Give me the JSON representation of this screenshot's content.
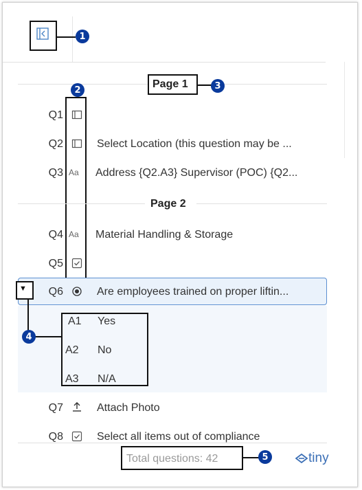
{
  "toolbar": {
    "collapse_icon": "collapse-panel-icon"
  },
  "pages": [
    {
      "label": "Page 1"
    },
    {
      "label": "Page 2"
    }
  ],
  "questions": [
    {
      "num": "Q1",
      "icon": "section-icon",
      "text": ""
    },
    {
      "num": "Q2",
      "icon": "section-icon",
      "text": "Select Location (this question may be ..."
    },
    {
      "num": "Q3",
      "icon": "text-field-icon",
      "icon_text": "Aa",
      "text": "Address {Q2.A3} Supervisor (POC) {Q2..."
    },
    {
      "num": "Q4",
      "icon": "text-field-icon",
      "icon_text": "Aa",
      "text": "Material Handling & Storage"
    },
    {
      "num": "Q5",
      "icon": "checkbox-icon",
      "text": ""
    },
    {
      "num": "Q6",
      "icon": "radio-icon",
      "text": "Are employees trained on proper liftin..."
    },
    {
      "num": "Q7",
      "icon": "upload-icon",
      "text": "Attach Photo"
    },
    {
      "num": "Q8",
      "icon": "checkbox-icon",
      "text": "Select all items out of compliance"
    }
  ],
  "expand_toggle": "▼",
  "answers": [
    {
      "num": "A1",
      "text": "Yes"
    },
    {
      "num": "A2",
      "text": "No"
    },
    {
      "num": "A3",
      "text": "N/A"
    }
  ],
  "footer": {
    "total_questions": "Total questions: 42",
    "brand": "tiny"
  },
  "callouts": [
    "1",
    "2",
    "3",
    "4",
    "5"
  ],
  "colors": {
    "callout": "#0a3a9c",
    "selected_row_bg": "#eaf2fb",
    "selected_row_border": "#5b8fd1",
    "answers_bg": "#f3f7fc",
    "brand": "#3b6fb6"
  }
}
